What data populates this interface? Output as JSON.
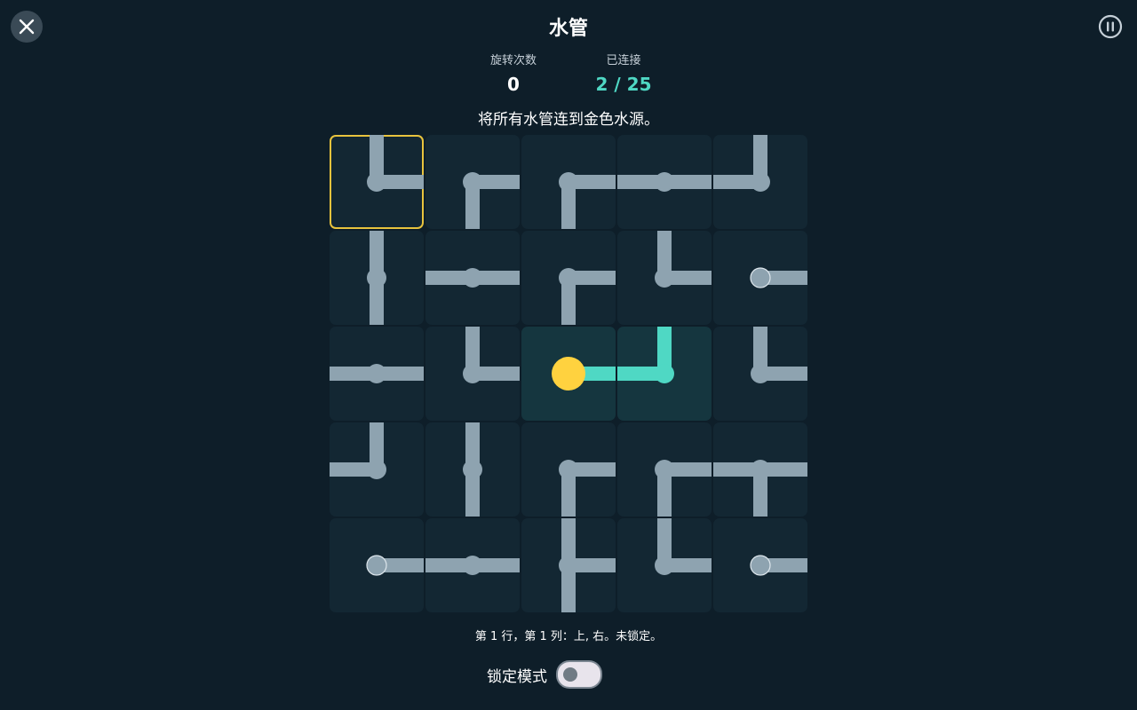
{
  "header": {
    "title": "水管",
    "close_icon": "close-icon",
    "pause_icon": "pause-icon"
  },
  "stats": {
    "moves_label": "旋转次数",
    "moves_value": "0",
    "connected_label": "已连接",
    "connected_value": "2 / 25"
  },
  "instruction": "将所有水管连到金色水源。",
  "board": {
    "rows": 5,
    "cols": 5,
    "selected": {
      "row": 1,
      "col": 1
    },
    "colors": {
      "pipe": "#8ea3b0",
      "water": "#4fd8c4",
      "source": "#ffd23f",
      "tile": "#132733",
      "tile_powered": "#15363f",
      "selection": "#e8c33d"
    },
    "tiles": [
      [
        {
          "row": 1,
          "col": 1,
          "open": [
            "up",
            "right"
          ],
          "powered": false,
          "source": false
        },
        {
          "row": 1,
          "col": 2,
          "open": [
            "right",
            "down"
          ],
          "powered": false,
          "source": false
        },
        {
          "row": 1,
          "col": 3,
          "open": [
            "right",
            "down"
          ],
          "powered": false,
          "source": false
        },
        {
          "row": 1,
          "col": 4,
          "open": [
            "left",
            "right"
          ],
          "powered": false,
          "source": false
        },
        {
          "row": 1,
          "col": 5,
          "open": [
            "up",
            "left"
          ],
          "powered": false,
          "source": false
        }
      ],
      [
        {
          "row": 2,
          "col": 1,
          "open": [
            "up",
            "down"
          ],
          "powered": false,
          "source": false
        },
        {
          "row": 2,
          "col": 2,
          "open": [
            "left",
            "right"
          ],
          "powered": false,
          "source": false
        },
        {
          "row": 2,
          "col": 3,
          "open": [
            "right",
            "down"
          ],
          "powered": false,
          "source": false
        },
        {
          "row": 2,
          "col": 4,
          "open": [
            "up",
            "right"
          ],
          "powered": false,
          "source": false
        },
        {
          "row": 2,
          "col": 5,
          "open": [
            "right"
          ],
          "powered": false,
          "source": false
        }
      ],
      [
        {
          "row": 3,
          "col": 1,
          "open": [
            "left",
            "right"
          ],
          "powered": false,
          "source": false
        },
        {
          "row": 3,
          "col": 2,
          "open": [
            "up",
            "right"
          ],
          "powered": false,
          "source": false
        },
        {
          "row": 3,
          "col": 3,
          "open": [
            "right"
          ],
          "powered": true,
          "source": true
        },
        {
          "row": 3,
          "col": 4,
          "open": [
            "up",
            "left"
          ],
          "powered": true,
          "source": false
        },
        {
          "row": 3,
          "col": 5,
          "open": [
            "up",
            "right"
          ],
          "powered": false,
          "source": false
        }
      ],
      [
        {
          "row": 4,
          "col": 1,
          "open": [
            "up",
            "left"
          ],
          "powered": false,
          "source": false
        },
        {
          "row": 4,
          "col": 2,
          "open": [
            "up",
            "down"
          ],
          "powered": false,
          "source": false
        },
        {
          "row": 4,
          "col": 3,
          "open": [
            "right",
            "down"
          ],
          "powered": false,
          "source": false
        },
        {
          "row": 4,
          "col": 4,
          "open": [
            "right",
            "down"
          ],
          "powered": false,
          "source": false
        },
        {
          "row": 4,
          "col": 5,
          "open": [
            "left",
            "right",
            "down"
          ],
          "powered": false,
          "source": false
        }
      ],
      [
        {
          "row": 5,
          "col": 1,
          "open": [
            "right"
          ],
          "powered": false,
          "source": false
        },
        {
          "row": 5,
          "col": 2,
          "open": [
            "left",
            "right"
          ],
          "powered": false,
          "source": false
        },
        {
          "row": 5,
          "col": 3,
          "open": [
            "up",
            "right",
            "down"
          ],
          "powered": false,
          "source": false
        },
        {
          "row": 5,
          "col": 4,
          "open": [
            "up",
            "right"
          ],
          "powered": false,
          "source": false
        },
        {
          "row": 5,
          "col": 5,
          "open": [
            "right"
          ],
          "powered": false,
          "source": false
        }
      ]
    ]
  },
  "status_text": "第 1 行，第 1 列：上, 右。未锁定。",
  "lock_mode": {
    "label": "锁定模式",
    "enabled": false
  }
}
